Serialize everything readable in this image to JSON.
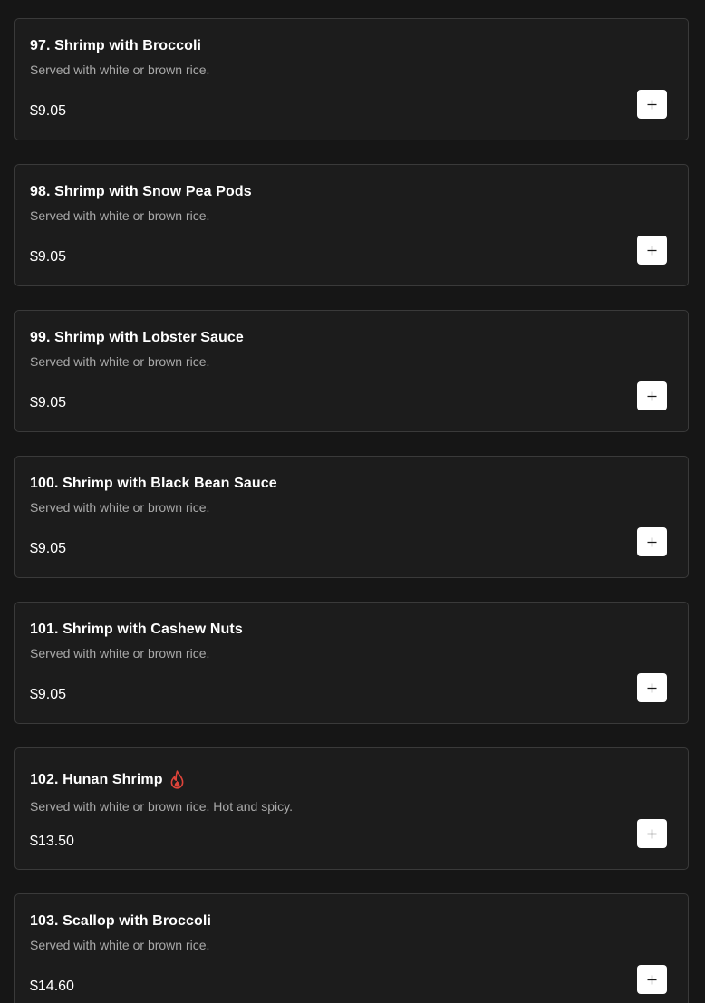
{
  "items": [
    {
      "title": "97. Shrimp with Broccoli",
      "description": "Served with white or brown rice.",
      "price": "$9.05",
      "spicy": false
    },
    {
      "title": "98. Shrimp with Snow Pea Pods",
      "description": "Served with white or brown rice.",
      "price": "$9.05",
      "spicy": false
    },
    {
      "title": "99. Shrimp with Lobster Sauce",
      "description": "Served with white or brown rice.",
      "price": "$9.05",
      "spicy": false
    },
    {
      "title": "100. Shrimp with Black Bean Sauce",
      "description": "Served with white or brown rice.",
      "price": "$9.05",
      "spicy": false
    },
    {
      "title": "101. Shrimp with Cashew Nuts",
      "description": "Served with white or brown rice.",
      "price": "$9.05",
      "spicy": false
    },
    {
      "title": "102. Hunan Shrimp",
      "description": "Served with white or brown rice. Hot and spicy.",
      "price": "$13.50",
      "spicy": true
    },
    {
      "title": "103. Scallop with Broccoli",
      "description": "Served with white or brown rice.",
      "price": "$14.60",
      "spicy": false
    }
  ],
  "icons": {
    "add": "plus-icon",
    "spicy": "flame-icon"
  },
  "colors": {
    "background": "#161616",
    "card": "#1c1c1c",
    "border": "#3a3a3a",
    "spicy": "#e0443a",
    "button": "#ffffff"
  }
}
